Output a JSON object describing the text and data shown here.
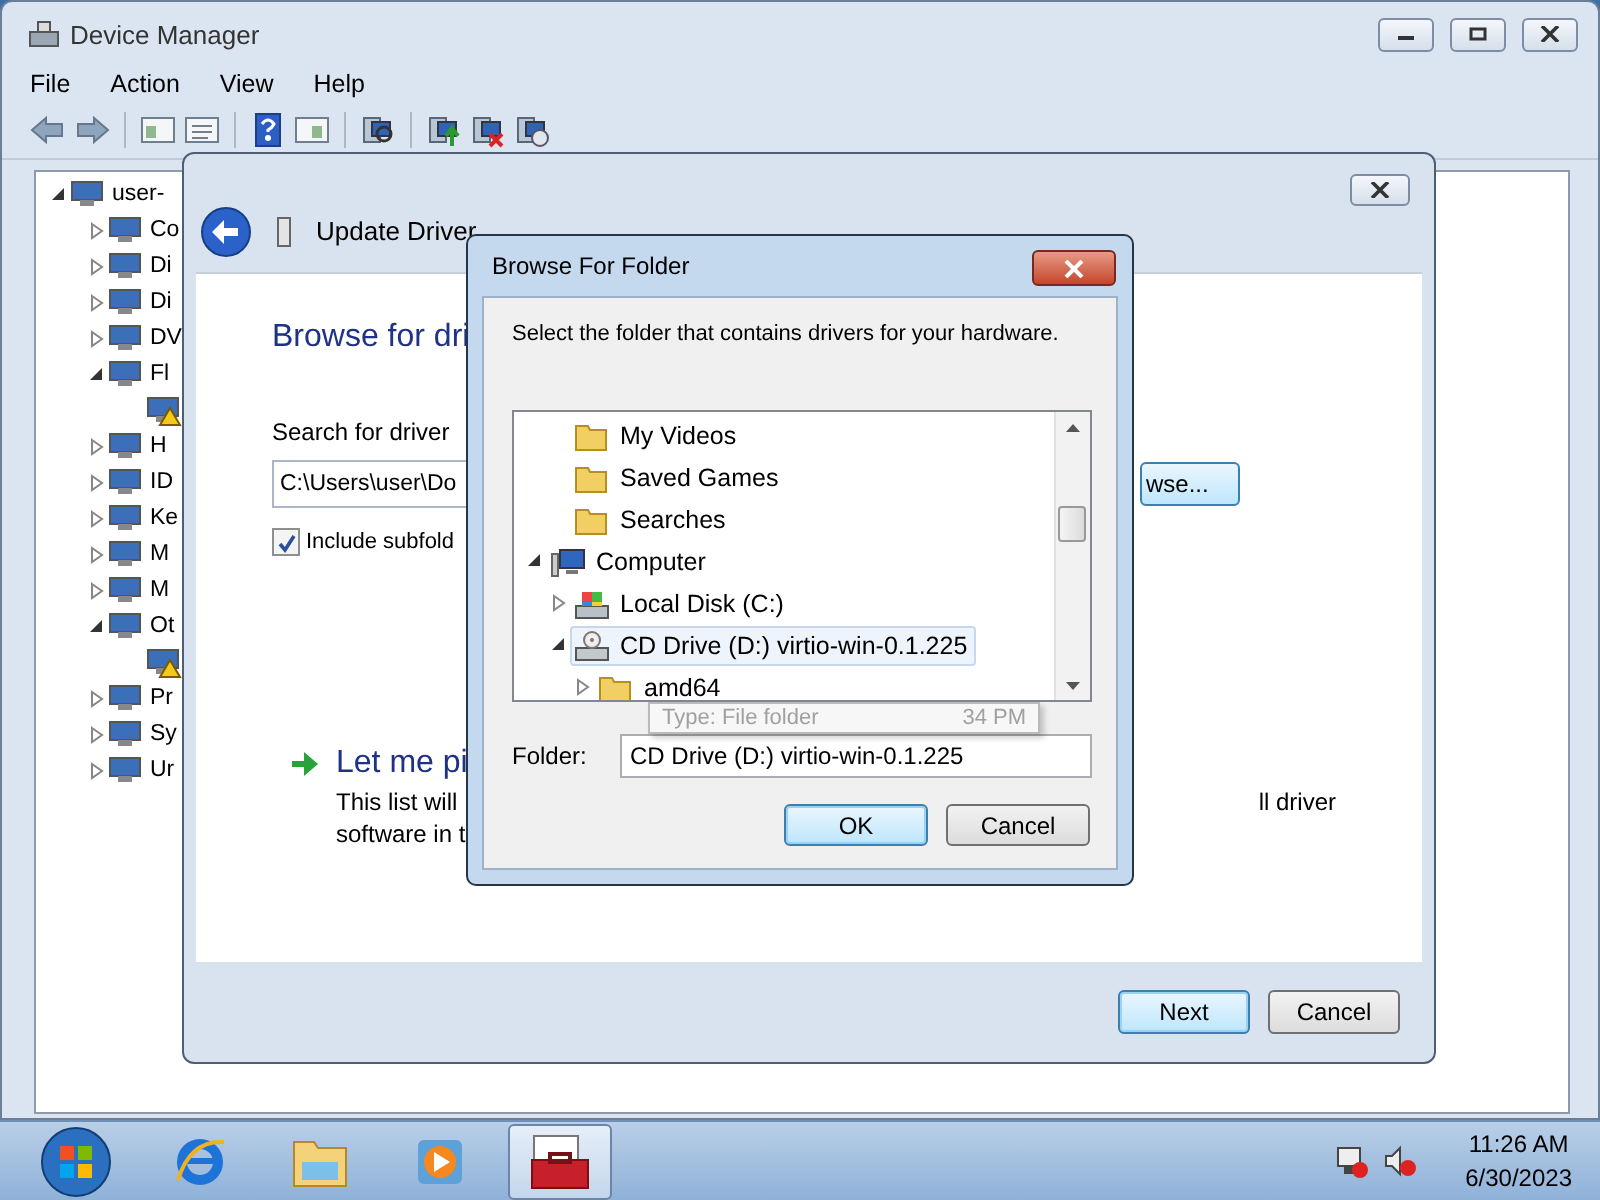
{
  "device_manager": {
    "title": "Device Manager",
    "menu": [
      "File",
      "Action",
      "View",
      "Help"
    ],
    "tree": [
      {
        "label": "user-",
        "expanded": true,
        "children": [
          {
            "label": "Co",
            "expanded": false
          },
          {
            "label": "Di",
            "expanded": false
          },
          {
            "label": "Di",
            "expanded": false
          },
          {
            "label": "DV",
            "expanded": false
          },
          {
            "label": "Fl",
            "expanded": true,
            "children": [
              {
                "warning": true
              }
            ]
          },
          {
            "label": "H",
            "expanded": false
          },
          {
            "label": "ID",
            "expanded": false
          },
          {
            "label": "Ke",
            "expanded": false
          },
          {
            "label": "M",
            "expanded": false
          },
          {
            "label": "M",
            "expanded": false
          },
          {
            "label": "Ot",
            "expanded": true,
            "children": [
              {
                "warning": true
              }
            ]
          },
          {
            "label": "Pr",
            "expanded": false
          },
          {
            "label": "Sy",
            "expanded": false
          },
          {
            "label": "Ur",
            "expanded": false
          }
        ]
      }
    ]
  },
  "update_driver": {
    "title": "Update Driver",
    "heading": "Browse for dri",
    "search_label": "Search for driver",
    "path": "C:\\Users\\user\\Do",
    "browse_button": "wse...",
    "include_subfolders": {
      "label": "Include subfold",
      "checked": true
    },
    "pick_title": "Let me pi",
    "pick_desc_lines": [
      "This list will",
      "software in t"
    ],
    "pick_desc_tail": "ll driver",
    "buttons": [
      {
        "label": "Next",
        "default": true
      },
      {
        "label": "Cancel",
        "default": false
      }
    ]
  },
  "browse_folder": {
    "title": "Browse For Folder",
    "instruction": "Select the folder that contains drivers for your hardware.",
    "tree": [
      {
        "kind": "continued",
        "children": [
          {
            "label": "My Videos",
            "kind": "folder",
            "selected": false
          },
          {
            "label": "Saved Games",
            "kind": "folder",
            "selected": false
          },
          {
            "label": "Searches",
            "kind": "folder",
            "selected": false
          }
        ]
      },
      {
        "label": "Computer",
        "kind": "computer",
        "expanded": true,
        "selected": false,
        "children": [
          {
            "label": "Local Disk (C:)",
            "kind": "disk",
            "expanded": false,
            "selected": false
          },
          {
            "label": "CD Drive (D:) virtio-win-0.1.225",
            "kind": "cd",
            "expanded": true,
            "selected": true,
            "children": [
              {
                "label": "amd64",
                "kind": "folder",
                "expanded": false,
                "selected": false
              }
            ]
          }
        ]
      }
    ],
    "folder_label": "Folder:",
    "folder_value": "CD Drive (D:) virtio-win-0.1.225",
    "tooltip": {
      "line_1": "Type: File folder",
      "line_2_tail": "34 PM"
    },
    "buttons": [
      {
        "label": "OK",
        "default": true
      },
      {
        "label": "Cancel",
        "default": false
      }
    ]
  },
  "taskbar": {
    "apps": [
      {
        "kind": "browser",
        "active": false
      },
      {
        "kind": "explorer",
        "active": false
      },
      {
        "kind": "media",
        "active": false
      },
      {
        "kind": "devmgr",
        "active": true
      }
    ],
    "time": "11:26 AM",
    "date": "6/30/2023"
  }
}
